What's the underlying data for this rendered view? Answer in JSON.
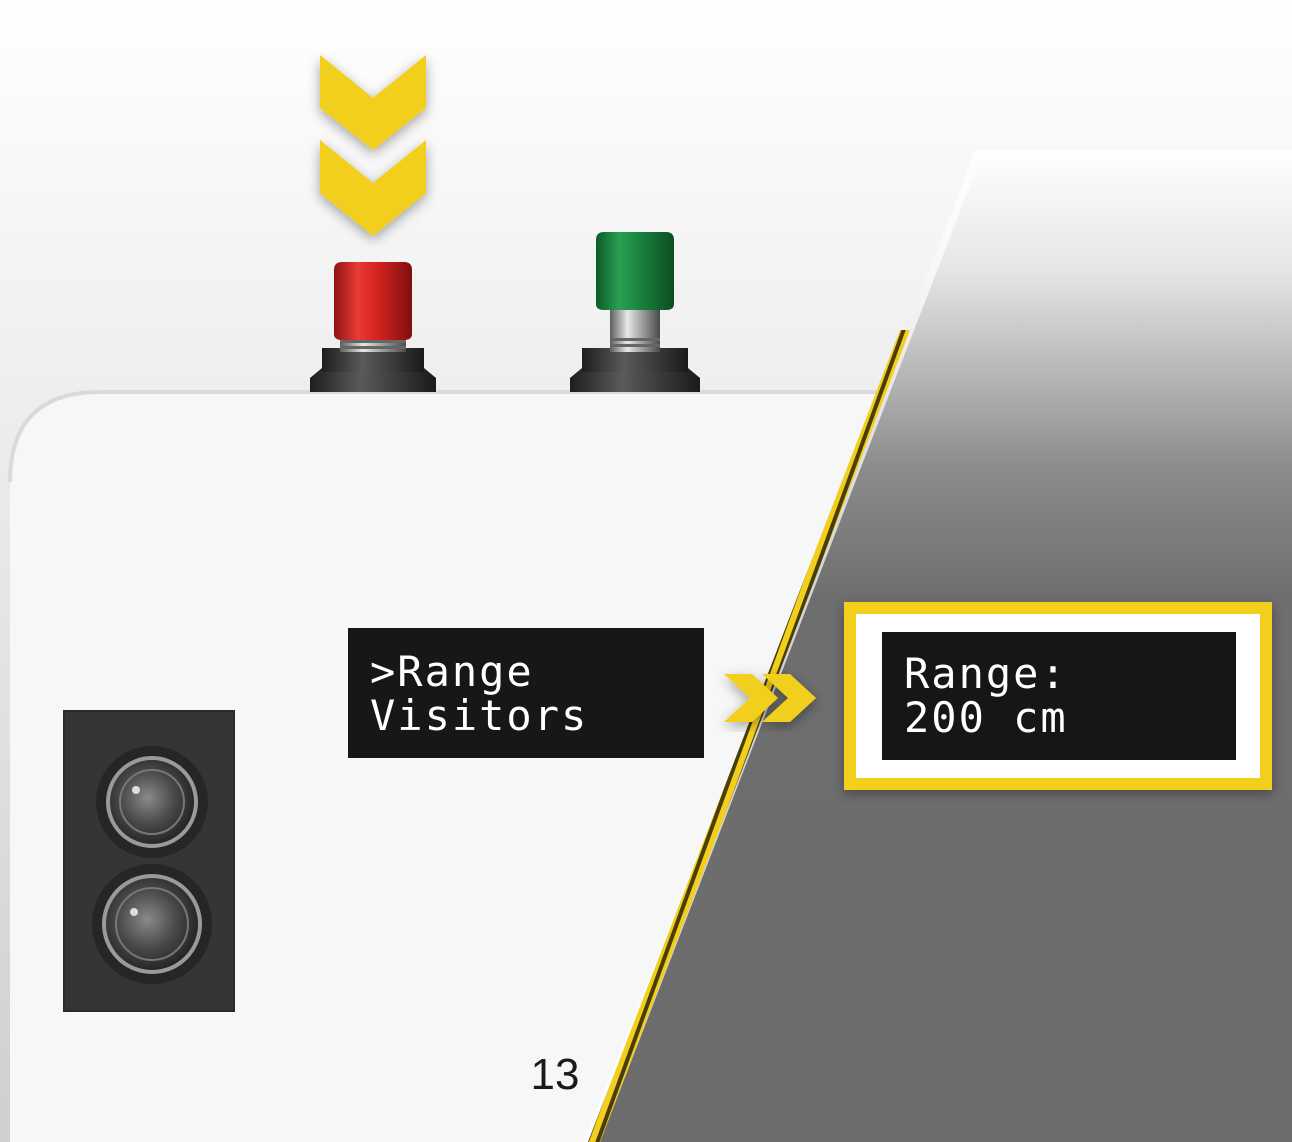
{
  "colors": {
    "accent_yellow": "#f2cf1c",
    "red_button": "#d42a28",
    "green_button": "#1f8a43",
    "panel_white": "#f7f7f7",
    "dark_background": "#6d6d6d",
    "lcd_background": "#171717"
  },
  "icons": [
    "chevron-down-icon",
    "chevron-right-icon"
  ],
  "menu_lcd": {
    "line1": ">Range",
    "line2": "Visitors"
  },
  "result_lcd": {
    "line1": "Range:",
    "line2": "200 cm"
  },
  "page_number": "13"
}
